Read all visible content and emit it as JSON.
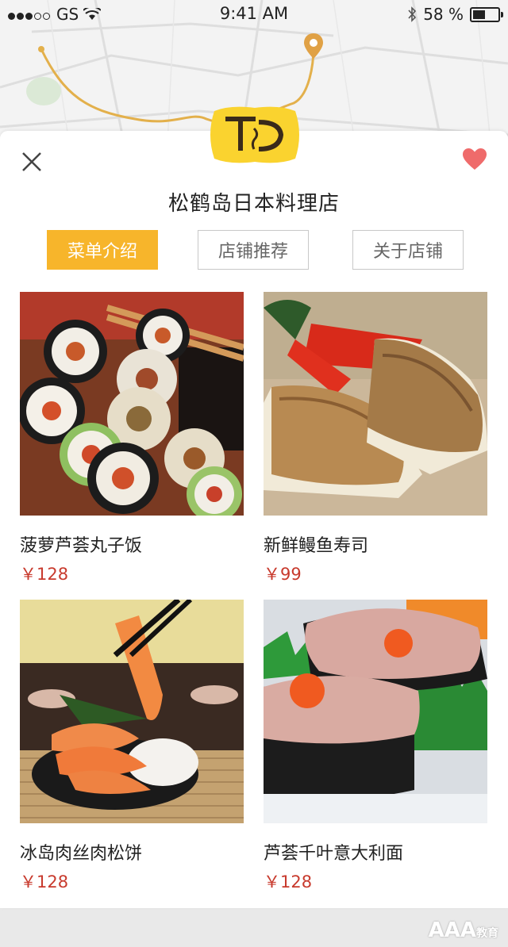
{
  "status_bar": {
    "carrier": "GS",
    "time": "9:41 AM",
    "battery": "58 %",
    "battery_level_percent": 58
  },
  "map": {
    "route_color": "#e3b04b",
    "pin_color": "#e0a145"
  },
  "header": {
    "logo_text": "TD",
    "restaurant_name": "松鹤岛日本料理店",
    "favorite_color": "#ef6b6b"
  },
  "tabs": [
    {
      "label": "菜单介绍",
      "active": true
    },
    {
      "label": "店铺推荐",
      "active": false
    },
    {
      "label": "关于店铺",
      "active": false
    }
  ],
  "menu_items": [
    {
      "name": "菠萝芦荟丸子饭",
      "price": "￥128"
    },
    {
      "name": "新鲜鳗鱼寿司",
      "price": "￥99"
    },
    {
      "name": "冰岛肉丝肉松饼",
      "price": "￥128"
    },
    {
      "name": "芦荟千叶意大利面",
      "price": "￥128"
    }
  ],
  "watermark": {
    "main": "AAA",
    "sub": "教育"
  }
}
